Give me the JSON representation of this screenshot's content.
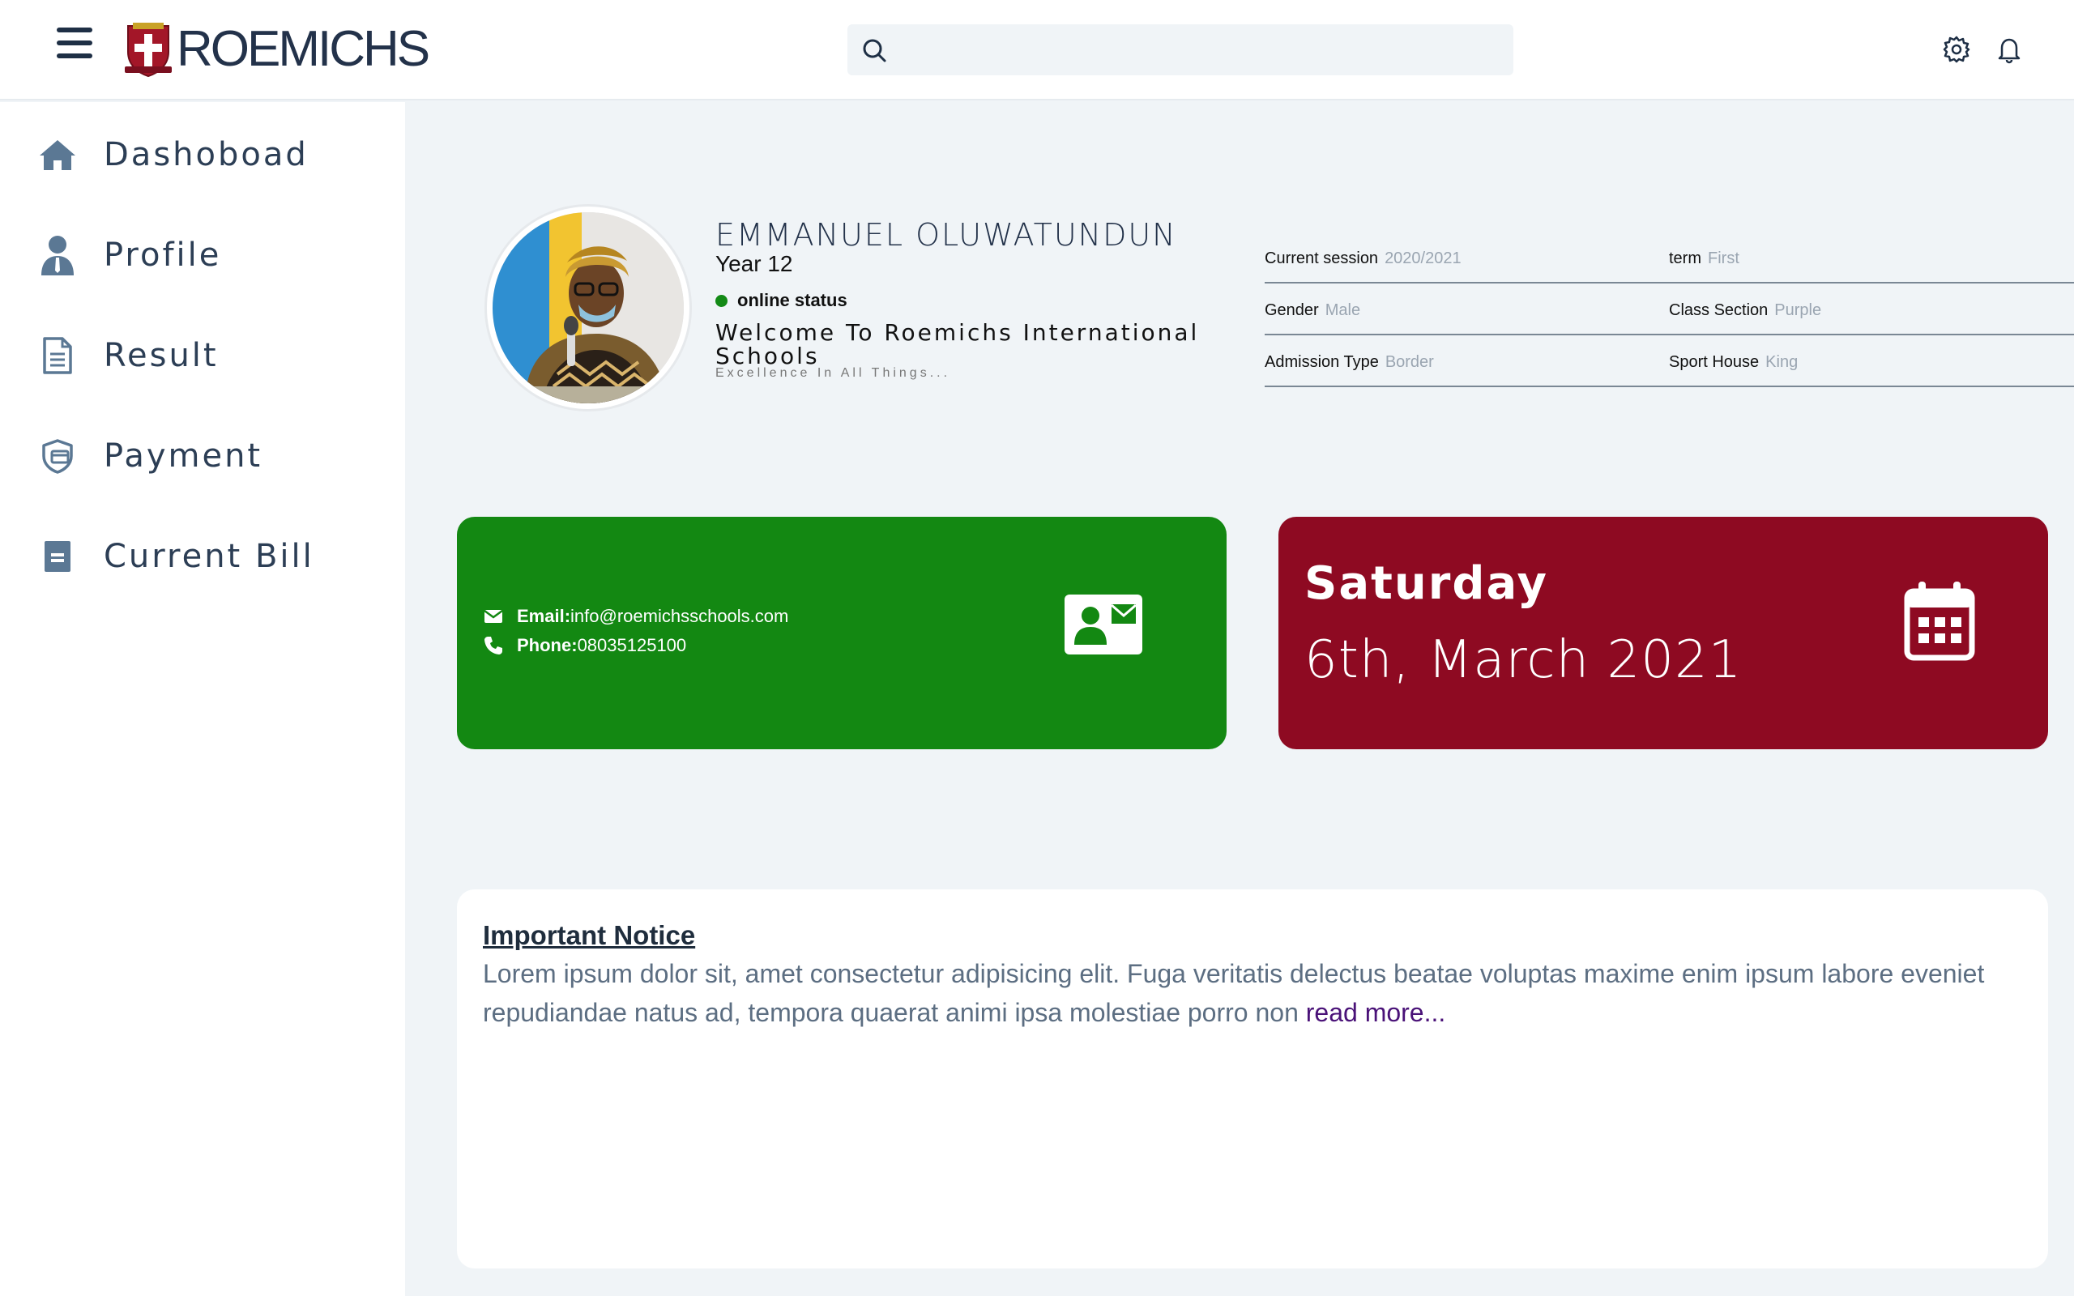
{
  "app": {
    "logo_text": "ROEMICHS"
  },
  "search": {
    "placeholder": ""
  },
  "sidebar": {
    "items": [
      {
        "label": "Dashoboad",
        "icon": "home-icon"
      },
      {
        "label": "Profile",
        "icon": "user-icon"
      },
      {
        "label": "Result",
        "icon": "document-icon"
      },
      {
        "label": "Payment",
        "icon": "payment-icon"
      },
      {
        "label": "Current Bill",
        "icon": "bill-icon"
      }
    ]
  },
  "profile": {
    "name": "EMMANUEL OLUWATUNDUN",
    "year": "Year 12",
    "status": "online status",
    "welcome": "Welcome To Roemichs International Schools",
    "motto": "Excellence In All Things..."
  },
  "info": {
    "current_session_label": "Current session",
    "current_session_value": "2020/2021",
    "term_label": "term",
    "term_value": "First",
    "gender_label": "Gender",
    "gender_value": "Male",
    "class_section_label": "Class Section",
    "class_section_value": "Purple",
    "admission_type_label": "Admission Type",
    "admission_type_value": "Border",
    "sport_house_label": "Sport House",
    "sport_house_value": "King"
  },
  "contact": {
    "email_label": "Email:",
    "email_value": "info@roemichsschools.com",
    "phone_label": "Phone:",
    "phone_value": "08035125100"
  },
  "date_card": {
    "day": "Saturday",
    "date": "6th, March 2021"
  },
  "notice": {
    "title": "Important Notice",
    "body": "Lorem ipsum dolor sit, amet consectetur adipisicing elit. Fuga veritatis delectus beatae voluptas maxime enim ipsum labore eveniet repudiandae natus ad, tempora quaerat animi ipsa molestiae porro non ",
    "read_more": "read more..."
  },
  "colors": {
    "green_card": "#138812",
    "red_card": "#8e0a22",
    "online_dot": "#138a16",
    "read_more": "#4a1278",
    "nav_icon": "#5b7894"
  }
}
